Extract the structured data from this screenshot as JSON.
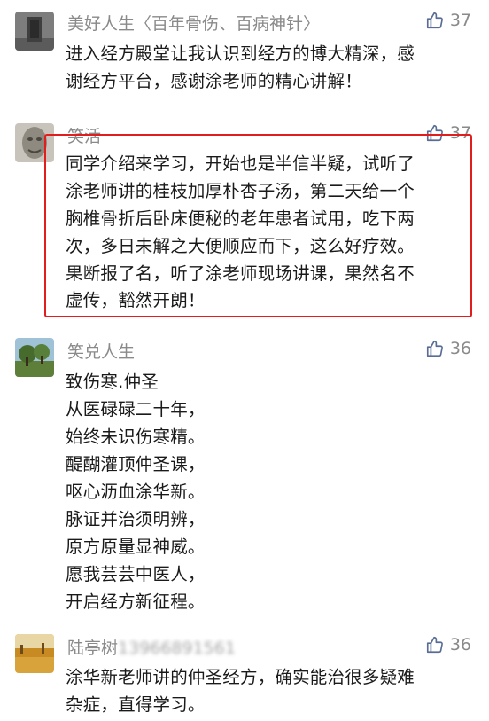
{
  "comments": [
    {
      "user": "美好人生〈百年骨伤、百病神针〉",
      "likes": "37",
      "lines": [
        "进入经方殿堂让我认识到经方的博大精深，感",
        "谢经方平台，感谢涂老师的精心讲解！"
      ]
    },
    {
      "user": "笑活",
      "likes": "37",
      "lines": [
        "同学介绍来学习，开始也是半信半疑，试听了",
        "涂老师讲的桂枝加厚朴杏子汤，第二天给一个",
        "胸椎骨折后卧床便秘的老年患者试用，吃下两",
        "次，多日未解之大便顺应而下，这么好疗效。",
        "果断报了名，听了涂老师现场讲课，果然名不",
        "虚传，豁然开朗！"
      ]
    },
    {
      "user": "笑兑人生",
      "likes": "36",
      "lines": [
        "致伤寒.仲圣",
        "从医碌碌二十年，",
        "始终未识伤寒精。",
        "醍醐灌顶仲圣课，",
        "呕心沥血涂华新。",
        "脉证并治须明辨，",
        "原方原量显神威。",
        "愿我芸芸中医人，",
        "开启经方新征程。"
      ]
    },
    {
      "user": "陆亭树",
      "user_suffix": "13966891561",
      "likes": "36",
      "lines": [
        "涂华新老师讲的仲圣经方，确实能治很多疑难",
        "杂症，直得学习。"
      ]
    }
  ],
  "colors": {
    "highlight": "#e21d1d",
    "name": "#8a8a8a",
    "text": "#1a1a1a"
  },
  "icons": {
    "like": "thumbs-up-icon"
  }
}
